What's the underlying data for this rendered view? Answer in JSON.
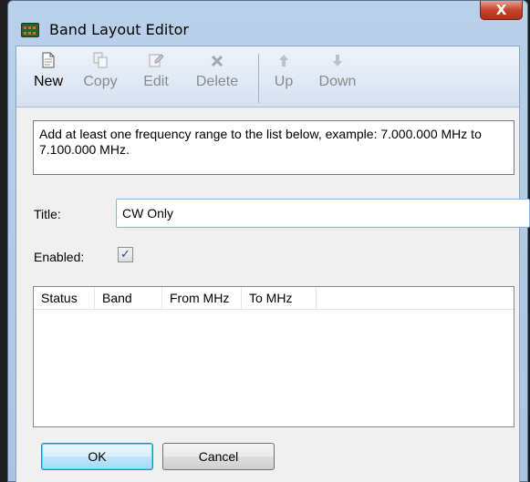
{
  "window": {
    "title": "Band Layout Editor",
    "close_glyph": "X"
  },
  "toolbar": {
    "buttons": [
      {
        "label": "New",
        "icon": "new-document-icon",
        "enabled": true
      },
      {
        "label": "Copy",
        "icon": "copy-icon",
        "enabled": false
      },
      {
        "label": "Edit",
        "icon": "edit-icon",
        "enabled": false
      },
      {
        "label": "Delete",
        "icon": "delete-icon",
        "enabled": false
      },
      {
        "label": "Up",
        "icon": "arrow-up-icon",
        "enabled": false
      },
      {
        "label": "Down",
        "icon": "arrow-down-icon",
        "enabled": false
      }
    ]
  },
  "info": {
    "text": "Add at least one frequency range to the list below, example: 7.000.000 MHz to 7.100.000 MHz."
  },
  "form": {
    "title_label": "Title:",
    "title_value": "CW Only",
    "enabled_label": "Enabled:",
    "enabled_checked": true,
    "enabled_mark": "✓"
  },
  "list": {
    "columns": [
      "Status",
      "Band",
      "From MHz",
      "To MHz"
    ],
    "rows": []
  },
  "buttons": {
    "ok": "OK",
    "cancel": "Cancel"
  },
  "colors": {
    "title_bar": "#b9d1ea",
    "close_button": "#c7432c",
    "input_focus_border": "#7eb4ea"
  }
}
